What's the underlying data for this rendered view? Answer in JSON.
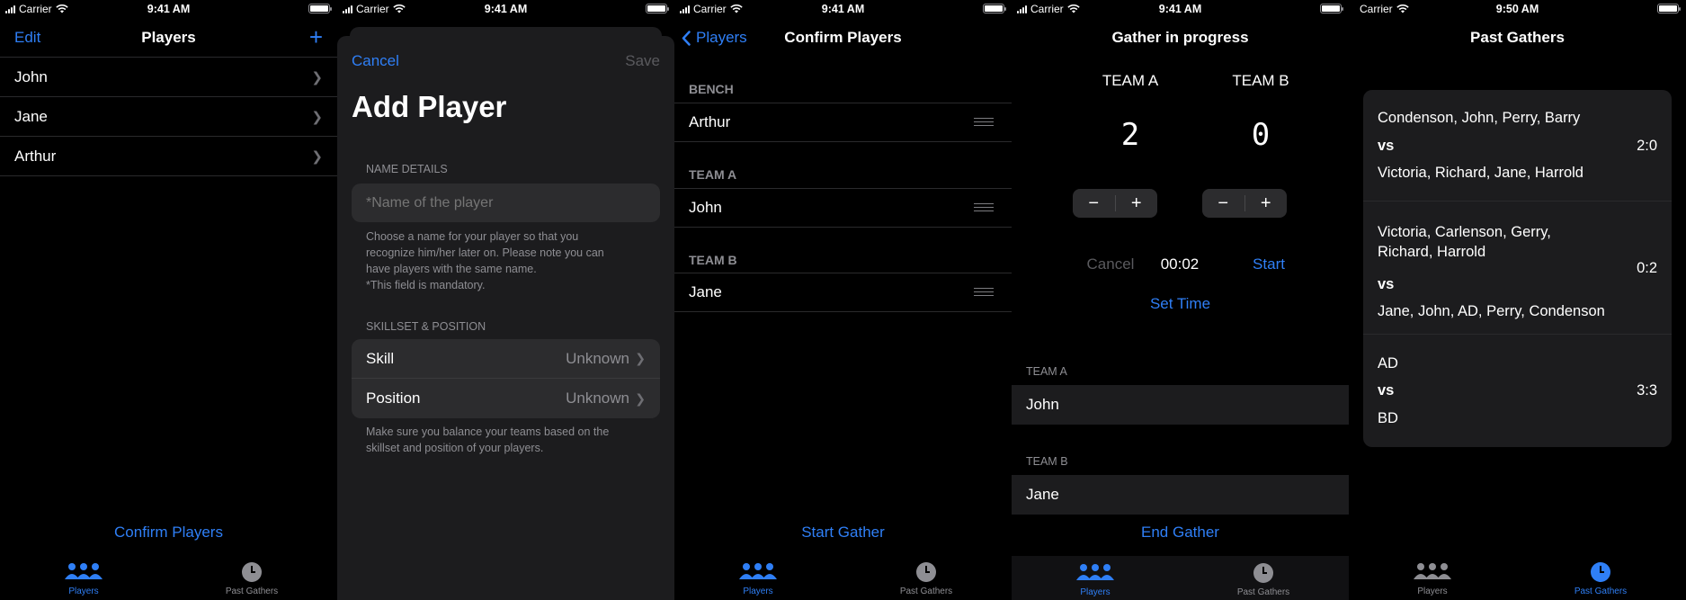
{
  "status": {
    "carrier": "Carrier",
    "time_a": "9:41 AM",
    "time_b": "9:50 AM"
  },
  "colors": {
    "accent": "#2f7ff6",
    "sheet": "#1c1c1e",
    "field": "#2c2c2e"
  },
  "screen1": {
    "edit": "Edit",
    "title": "Players",
    "add_icon": "plus-icon",
    "players": [
      "John",
      "Jane",
      "Arthur"
    ],
    "confirm": "Confirm Players"
  },
  "tabs": {
    "players": "Players",
    "past": "Past Gathers"
  },
  "screen2": {
    "cancel": "Cancel",
    "save": "Save",
    "title": "Add Player",
    "name_section": "NAME DETAILS",
    "name_placeholder": "*Name of the player",
    "name_help_1": "Choose a name for your player so that you",
    "name_help_2": "recognize him/her later on. Please note you can",
    "name_help_3": "have players with the same name.",
    "name_help_4": "*This field is mandatory.",
    "skill_section": "SKILLSET & POSITION",
    "skill_label": "Skill",
    "skill_value": "Unknown",
    "position_label": "Position",
    "position_value": "Unknown",
    "skill_help_1": "Make sure you balance your teams based on the",
    "skill_help_2": "skillset and position of your players."
  },
  "screen3": {
    "back": "Players",
    "title": "Confirm Players",
    "sections": [
      {
        "header": "BENCH",
        "player": "Arthur"
      },
      {
        "header": "TEAM A",
        "player": "John"
      },
      {
        "header": "TEAM B",
        "player": "Jane"
      }
    ],
    "start": "Start Gather"
  },
  "screen4": {
    "title": "Gather in progress",
    "team_a": "TEAM A",
    "team_b": "TEAM B",
    "score_a": "2",
    "score_b": "0",
    "minus": "−",
    "plus": "+",
    "cancel": "Cancel",
    "timer": "00:02",
    "start": "Start",
    "set_time": "Set Time",
    "list_a_header": "TEAM A",
    "list_a_player": "John",
    "list_b_header": "TEAM B",
    "list_b_player": "Jane",
    "end": "End Gather"
  },
  "screen5": {
    "title": "Past Gathers",
    "vs": "vs",
    "gathers": [
      {
        "team_a": "Condenson, John, Perry, Barry",
        "team_b": "Victoria, Richard, Jane, Harrold",
        "score": "2:0"
      },
      {
        "team_a_l1": "Victoria, Carlenson, Gerry,",
        "team_a_l2": "Richard, Harrold",
        "team_b": "Jane, John, AD, Perry, Condenson",
        "score": "0:2"
      },
      {
        "team_a": "AD",
        "team_b": "BD",
        "score": "3:3"
      }
    ]
  }
}
